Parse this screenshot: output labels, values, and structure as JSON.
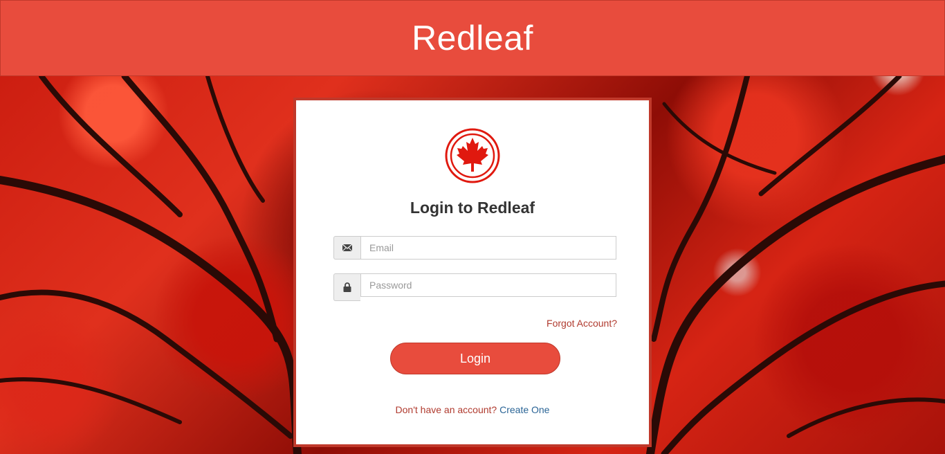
{
  "header": {
    "title": "Redleaf"
  },
  "login": {
    "title": "Login to Redleaf",
    "email_placeholder": "Email",
    "password_placeholder": "Password",
    "forgot_link": "Forgot Account?",
    "login_button": "Login",
    "signup_prompt": "Don't have an account?",
    "signup_link": "Create One"
  },
  "icons": {
    "logo": "maple-leaf-icon",
    "email": "envelope-icon",
    "password": "lock-icon"
  },
  "colors": {
    "brand": "#e84c3d",
    "brand_dark": "#c0392b",
    "link_red": "#b03a2e",
    "link_blue": "#2a6496"
  }
}
